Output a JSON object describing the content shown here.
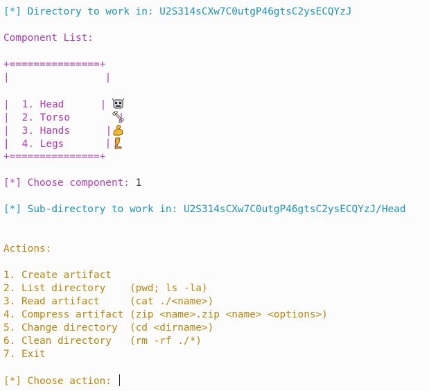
{
  "terminal": {
    "prompt_prefix": "[*]",
    "dir_label": " Directory to work in: ",
    "dir_value": "U2S314sCXw7C0utgP46gtsC2ysECQYzJ",
    "component_list_title": "Component List:",
    "box_border": "+===============+",
    "box_side_left": "|",
    "box_side_right": "|",
    "components": [
      {
        "num": "1.",
        "name": "Head",
        "icon": "robot-face-icon"
      },
      {
        "num": "2.",
        "name": "Torso",
        "icon": "bone-icon"
      },
      {
        "num": "3.",
        "name": "Hands",
        "icon": "flexed-biceps-icon"
      },
      {
        "num": "4.",
        "name": "Legs",
        "icon": "leg-icon"
      }
    ],
    "choose_component_label": " Choose component: ",
    "choose_component_value": "1",
    "subdir_label": " Sub-directory to work in: ",
    "subdir_value": "U2S314sCXw7C0utgP46gtsC2ysECQYzJ/Head",
    "actions_title": "Actions:",
    "actions": [
      {
        "text": "1. Create artifact"
      },
      {
        "text": "2. List directory    (pwd; ls -la)"
      },
      {
        "text": "3. Read artifact     (cat ./<name>)"
      },
      {
        "text": "4. Compress artifact (zip <name>.zip <name> <options>)"
      },
      {
        "text": "5. Change directory  (cd <dirname>)"
      },
      {
        "text": "6. Clean directory   (rm -rf ./*)"
      },
      {
        "text": "7. Exit"
      }
    ],
    "choose_action_label": " Choose action: ",
    "choose_action_value": ""
  },
  "colors": {
    "cyan": "#1a93b8",
    "magenta": "#b03cb0",
    "gold": "#b8860b",
    "background": "#fcfcfc"
  }
}
